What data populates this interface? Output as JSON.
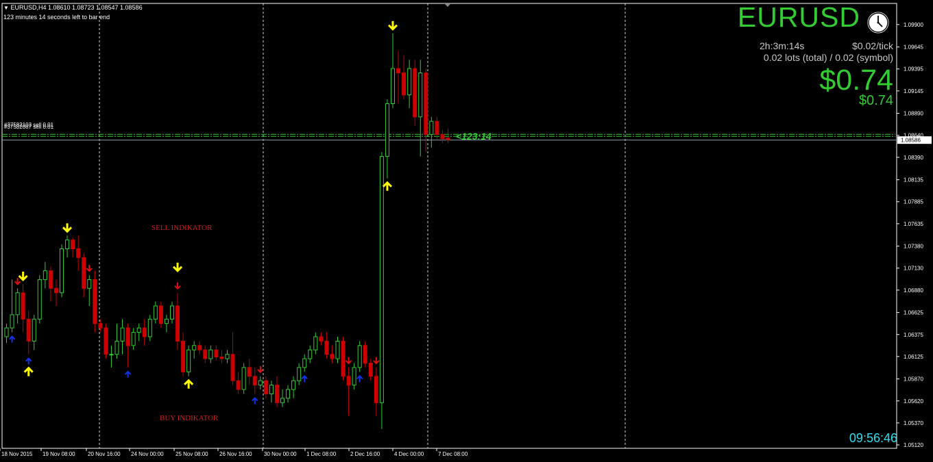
{
  "header": {
    "line1": "EURUSD,H4  1.08610 1.08723 1.08547 1.08586",
    "line2": "123 minutes 14 seconds left to bar end"
  },
  "panel": {
    "symbol": "EURUSD",
    "countdown": "2h:3m:14s",
    "tick_value": "$0.02/tick",
    "lots": "0.02 lots (total) / 0.02 (symbol)",
    "profit_big": "$0.74",
    "profit_small": "$0.74",
    "clock_icon": "clock-icon",
    "color": "#33cc33"
  },
  "bar_timer": "<123:14",
  "time_display": "09:56:46",
  "orders": [
    {
      "label": "#37582103 sell 0.01"
    },
    {
      "label": "#37582087 sell 0.01"
    }
  ],
  "annotations": {
    "sell": "SELL INDIKATOR",
    "buy": "BUY INDIKATOR"
  },
  "chart_data": {
    "type": "candlestick",
    "symbol": "EURUSD",
    "timeframe": "H4",
    "ylim": [
      1.0512,
      1.1
    ],
    "current_price": "1.08586",
    "price_ticks": [
      "1.09900",
      "1.09645",
      "1.09395",
      "1.09145",
      "1.08890",
      "1.08640",
      "1.08390",
      "1.08135",
      "1.07885",
      "1.07635",
      "1.07380",
      "1.07130",
      "1.06880",
      "1.06625",
      "1.06375",
      "1.06125",
      "1.05870",
      "1.05620",
      "1.05370",
      "1.05120"
    ],
    "time_ticks": [
      "18 Nov 2015",
      "19 Nov 08:00",
      "20 Nov 16:00",
      "24 Nov 00:00",
      "25 Nov 08:00",
      "26 Nov 16:00",
      "30 Nov 00:00",
      "1 Dec 08:00",
      "2 Dec 16:00",
      "4 Dec 00:00",
      "7 Dec 08:00"
    ],
    "order_level": 1.0864,
    "colors": {
      "bull": "#33cc33",
      "bear": "#cc0000",
      "grid": "#d8d8d8",
      "axis": "#ffffff",
      "bid": "#8a9ba8"
    },
    "candles": [
      {
        "o": 1.0635,
        "h": 1.065,
        "l": 1.0628,
        "c": 1.0645
      },
      {
        "o": 1.0645,
        "h": 1.07,
        "l": 1.064,
        "c": 1.066
      },
      {
        "o": 1.066,
        "h": 1.069,
        "l": 1.065,
        "c": 1.0685
      },
      {
        "o": 1.0685,
        "h": 1.0695,
        "l": 1.064,
        "c": 1.0655
      },
      {
        "o": 1.0655,
        "h": 1.0665,
        "l": 1.0615,
        "c": 1.063
      },
      {
        "o": 1.063,
        "h": 1.066,
        "l": 1.062,
        "c": 1.0655
      },
      {
        "o": 1.0655,
        "h": 1.0705,
        "l": 1.065,
        "c": 1.07
      },
      {
        "o": 1.07,
        "h": 1.072,
        "l": 1.069,
        "c": 1.071
      },
      {
        "o": 1.071,
        "h": 1.0715,
        "l": 1.0675,
        "c": 1.069
      },
      {
        "o": 1.069,
        "h": 1.07,
        "l": 1.067,
        "c": 1.0685
      },
      {
        "o": 1.0685,
        "h": 1.074,
        "l": 1.068,
        "c": 1.0735
      },
      {
        "o": 1.0735,
        "h": 1.075,
        "l": 1.0725,
        "c": 1.0745
      },
      {
        "o": 1.0745,
        "h": 1.0748,
        "l": 1.0725,
        "c": 1.0735
      },
      {
        "o": 1.0735,
        "h": 1.075,
        "l": 1.071,
        "c": 1.0725
      },
      {
        "o": 1.0725,
        "h": 1.073,
        "l": 1.068,
        "c": 1.069
      },
      {
        "o": 1.069,
        "h": 1.0705,
        "l": 1.067,
        "c": 1.07
      },
      {
        "o": 1.07,
        "h": 1.071,
        "l": 1.064,
        "c": 1.065
      },
      {
        "o": 1.065,
        "h": 1.0655,
        "l": 1.064,
        "c": 1.0645
      },
      {
        "o": 1.0645,
        "h": 1.065,
        "l": 1.061,
        "c": 1.0615
      },
      {
        "o": 1.0615,
        "h": 1.0625,
        "l": 1.06,
        "c": 1.0615
      },
      {
        "o": 1.0615,
        "h": 1.065,
        "l": 1.061,
        "c": 1.063
      },
      {
        "o": 1.063,
        "h": 1.0655,
        "l": 1.0615,
        "c": 1.0645
      },
      {
        "o": 1.0645,
        "h": 1.065,
        "l": 1.06,
        "c": 1.0625
      },
      {
        "o": 1.0625,
        "h": 1.0645,
        "l": 1.062,
        "c": 1.064
      },
      {
        "o": 1.064,
        "h": 1.065,
        "l": 1.063,
        "c": 1.0645
      },
      {
        "o": 1.0645,
        "h": 1.0655,
        "l": 1.0625,
        "c": 1.0635
      },
      {
        "o": 1.0635,
        "h": 1.066,
        "l": 1.063,
        "c": 1.0655
      },
      {
        "o": 1.0655,
        "h": 1.0675,
        "l": 1.065,
        "c": 1.067
      },
      {
        "o": 1.067,
        "h": 1.0675,
        "l": 1.0645,
        "c": 1.065
      },
      {
        "o": 1.065,
        "h": 1.066,
        "l": 1.064,
        "c": 1.0655
      },
      {
        "o": 1.0655,
        "h": 1.0675,
        "l": 1.065,
        "c": 1.067
      },
      {
        "o": 1.067,
        "h": 1.0685,
        "l": 1.062,
        "c": 1.063
      },
      {
        "o": 1.063,
        "h": 1.064,
        "l": 1.059,
        "c": 1.0595
      },
      {
        "o": 1.0595,
        "h": 1.0625,
        "l": 1.059,
        "c": 1.062
      },
      {
        "o": 1.062,
        "h": 1.063,
        "l": 1.061,
        "c": 1.0625
      },
      {
        "o": 1.0625,
        "h": 1.063,
        "l": 1.0615,
        "c": 1.062
      },
      {
        "o": 1.062,
        "h": 1.0625,
        "l": 1.0605,
        "c": 1.061
      },
      {
        "o": 1.061,
        "h": 1.0625,
        "l": 1.0605,
        "c": 1.062
      },
      {
        "o": 1.062,
        "h": 1.0625,
        "l": 1.0608,
        "c": 1.0612
      },
      {
        "o": 1.0612,
        "h": 1.062,
        "l": 1.0605,
        "c": 1.061
      },
      {
        "o": 1.061,
        "h": 1.062,
        "l": 1.0605,
        "c": 1.0615
      },
      {
        "o": 1.0615,
        "h": 1.064,
        "l": 1.058,
        "c": 1.0585
      },
      {
        "o": 1.0585,
        "h": 1.0595,
        "l": 1.057,
        "c": 1.0575
      },
      {
        "o": 1.0575,
        "h": 1.0605,
        "l": 1.057,
        "c": 1.06
      },
      {
        "o": 1.06,
        "h": 1.061,
        "l": 1.058,
        "c": 1.059
      },
      {
        "o": 1.059,
        "h": 1.06,
        "l": 1.057,
        "c": 1.058
      },
      {
        "o": 1.058,
        "h": 1.059,
        "l": 1.0575,
        "c": 1.0585
      },
      {
        "o": 1.0585,
        "h": 1.059,
        "l": 1.0565,
        "c": 1.057
      },
      {
        "o": 1.057,
        "h": 1.0585,
        "l": 1.056,
        "c": 1.058
      },
      {
        "o": 1.058,
        "h": 1.059,
        "l": 1.0555,
        "c": 1.056
      },
      {
        "o": 1.056,
        "h": 1.0575,
        "l": 1.0555,
        "c": 1.0565
      },
      {
        "o": 1.0565,
        "h": 1.058,
        "l": 1.056,
        "c": 1.0575
      },
      {
        "o": 1.0575,
        "h": 1.059,
        "l": 1.0565,
        "c": 1.0585
      },
      {
        "o": 1.0585,
        "h": 1.0605,
        "l": 1.058,
        "c": 1.06
      },
      {
        "o": 1.06,
        "h": 1.0615,
        "l": 1.0595,
        "c": 1.061
      },
      {
        "o": 1.061,
        "h": 1.0625,
        "l": 1.0605,
        "c": 1.062
      },
      {
        "o": 1.062,
        "h": 1.064,
        "l": 1.0615,
        "c": 1.0635
      },
      {
        "o": 1.0635,
        "h": 1.064,
        "l": 1.0625,
        "c": 1.063
      },
      {
        "o": 1.063,
        "h": 1.064,
        "l": 1.061,
        "c": 1.0615
      },
      {
        "o": 1.0615,
        "h": 1.0625,
        "l": 1.0605,
        "c": 1.061
      },
      {
        "o": 1.061,
        "h": 1.0635,
        "l": 1.0605,
        "c": 1.063
      },
      {
        "o": 1.063,
        "h": 1.0635,
        "l": 1.0585,
        "c": 1.059
      },
      {
        "o": 1.059,
        "h": 1.06,
        "l": 1.0545,
        "c": 1.058
      },
      {
        "o": 1.058,
        "h": 1.0605,
        "l": 1.0575,
        "c": 1.06
      },
      {
        "o": 1.06,
        "h": 1.063,
        "l": 1.0595,
        "c": 1.0625
      },
      {
        "o": 1.0625,
        "h": 1.063,
        "l": 1.06,
        "c": 1.0605
      },
      {
        "o": 1.0605,
        "h": 1.061,
        "l": 1.0585,
        "c": 1.059
      },
      {
        "o": 1.059,
        "h": 1.06,
        "l": 1.0545,
        "c": 1.056
      },
      {
        "o": 1.056,
        "h": 1.0845,
        "l": 1.053,
        "c": 1.084
      },
      {
        "o": 1.084,
        "h": 1.0905,
        "l": 1.0815,
        "c": 1.09
      },
      {
        "o": 1.09,
        "h": 1.098,
        "l": 1.0895,
        "c": 1.094
      },
      {
        "o": 1.094,
        "h": 1.096,
        "l": 1.09,
        "c": 1.0935
      },
      {
        "o": 1.0935,
        "h": 1.0955,
        "l": 1.0905,
        "c": 1.091
      },
      {
        "o": 1.091,
        "h": 1.095,
        "l": 1.0895,
        "c": 1.094
      },
      {
        "o": 1.094,
        "h": 1.095,
        "l": 1.0875,
        "c": 1.0885
      },
      {
        "o": 1.0885,
        "h": 1.095,
        "l": 1.084,
        "c": 1.0935
      },
      {
        "o": 1.0935,
        "h": 1.094,
        "l": 1.0845,
        "c": 1.0865
      },
      {
        "o": 1.0865,
        "h": 1.0885,
        "l": 1.085,
        "c": 1.088
      },
      {
        "o": 1.088,
        "h": 1.0885,
        "l": 1.086,
        "c": 1.0865
      },
      {
        "o": 1.0865,
        "h": 1.087,
        "l": 1.0855,
        "c": 1.086
      },
      {
        "o": 1.0861,
        "h": 1.0872,
        "l": 1.0855,
        "c": 1.0859
      }
    ],
    "signals": [
      {
        "i": 1,
        "type": "buy",
        "color": "blue"
      },
      {
        "i": 2,
        "type": "sell",
        "color": "red"
      },
      {
        "i": 3,
        "type": "sell",
        "color": "yellow"
      },
      {
        "i": 4,
        "type": "buy",
        "color": "blue"
      },
      {
        "i": 4,
        "type": "buy",
        "color": "yellow"
      },
      {
        "i": 11,
        "type": "sell",
        "color": "yellow"
      },
      {
        "i": 15,
        "type": "sell",
        "color": "red"
      },
      {
        "i": 22,
        "type": "buy",
        "color": "blue"
      },
      {
        "i": 31,
        "type": "sell",
        "color": "red"
      },
      {
        "i": 31,
        "type": "sell",
        "color": "yellow"
      },
      {
        "i": 33,
        "type": "buy",
        "color": "yellow"
      },
      {
        "i": 45,
        "type": "buy",
        "color": "blue"
      },
      {
        "i": 46,
        "type": "sell",
        "color": "red"
      },
      {
        "i": 54,
        "type": "buy",
        "color": "blue"
      },
      {
        "i": 62,
        "type": "sell",
        "color": "red"
      },
      {
        "i": 64,
        "type": "buy",
        "color": "blue"
      },
      {
        "i": 67,
        "type": "sell",
        "color": "red"
      },
      {
        "i": 69,
        "type": "buy",
        "color": "yellow"
      },
      {
        "i": 70,
        "type": "sell",
        "color": "yellow"
      }
    ]
  }
}
